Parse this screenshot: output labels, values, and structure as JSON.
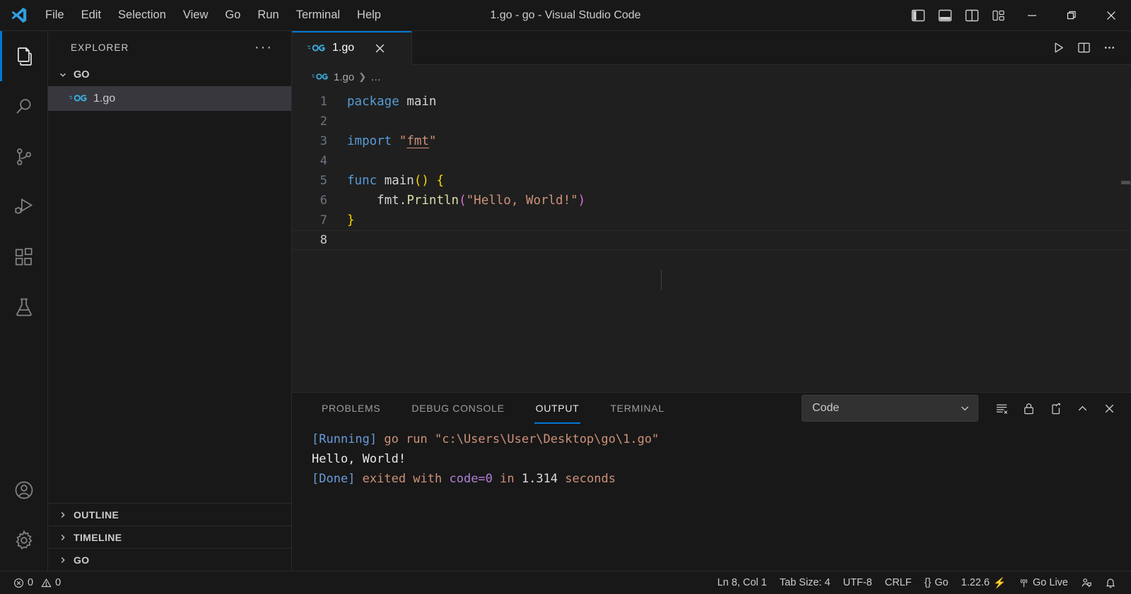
{
  "window": {
    "title": "1.go - go - Visual Studio Code",
    "menu": [
      "File",
      "Edit",
      "Selection",
      "View",
      "Go",
      "Run",
      "Terminal",
      "Help"
    ],
    "layout_buttons": [
      {
        "name": "toggle-primary-sidebar",
        "label": "Toggle Primary Side Bar"
      },
      {
        "name": "toggle-panel",
        "label": "Toggle Panel"
      },
      {
        "name": "toggle-secondary-sidebar",
        "label": "Toggle Secondary Side Bar"
      },
      {
        "name": "customize-layout",
        "label": "Customize Layout"
      }
    ],
    "controls": {
      "minimize": "—",
      "restore": "❐",
      "close": "✕"
    }
  },
  "activity_bar": {
    "items": [
      {
        "name": "explorer",
        "label": "Explorer",
        "icon": "files-icon",
        "active": true
      },
      {
        "name": "search",
        "label": "Search",
        "icon": "search-icon",
        "active": false
      },
      {
        "name": "source-control",
        "label": "Source Control",
        "icon": "source-control-icon",
        "active": false
      },
      {
        "name": "run-debug",
        "label": "Run and Debug",
        "icon": "run-debug-icon",
        "active": false
      },
      {
        "name": "extensions",
        "label": "Extensions",
        "icon": "extensions-icon",
        "active": false
      },
      {
        "name": "testing",
        "label": "Testing",
        "icon": "beaker-icon",
        "active": false
      }
    ],
    "bottom_items": [
      {
        "name": "accounts",
        "label": "Accounts",
        "icon": "account-icon"
      },
      {
        "name": "settings",
        "label": "Manage",
        "icon": "gear-icon"
      }
    ]
  },
  "sidebar": {
    "title": "EXPLORER",
    "more_actions": "···",
    "folder": {
      "label": "GO",
      "expanded": true
    },
    "files": [
      {
        "label": "1.go",
        "icon": "go-file-icon",
        "selected": true
      }
    ],
    "collapsed_sections": [
      {
        "label": "OUTLINE"
      },
      {
        "label": "TIMELINE"
      },
      {
        "label": "GO"
      }
    ]
  },
  "editor": {
    "tabs": [
      {
        "label": "1.go",
        "icon": "go-file-icon",
        "active": true,
        "close": "✕"
      }
    ],
    "actions": [
      {
        "name": "run-code-button",
        "icon": "play-icon"
      },
      {
        "name": "split-editor-button",
        "icon": "split-editor-icon"
      },
      {
        "name": "more-actions-button",
        "icon": "ellipsis-icon"
      }
    ],
    "breadcrumb": {
      "file": "1.go",
      "separator": "❯",
      "trail": "…"
    },
    "lines": [
      {
        "num": "1",
        "current": false
      },
      {
        "num": "2",
        "current": false
      },
      {
        "num": "3",
        "current": false
      },
      {
        "num": "4",
        "current": false
      },
      {
        "num": "5",
        "current": false
      },
      {
        "num": "6",
        "current": false
      },
      {
        "num": "7",
        "current": false
      },
      {
        "num": "8",
        "current": true
      }
    ],
    "code": {
      "l1_package": "package",
      "l1_main": "main",
      "l3_import": "import",
      "l3_quote_open": "\"",
      "l3_fmt": "fmt",
      "l3_quote_close": "\"",
      "l5_func": "func",
      "l5_main": "main",
      "l5_parens": "()",
      "l5_brace": "{",
      "l6_indent": "    ",
      "l6_fmt": "fmt",
      "l6_dot": ".",
      "l6_println": "Println",
      "l6_paren_open": "(",
      "l6_string": "\"Hello, World!\"",
      "l6_paren_close": ")",
      "l7_brace": "}"
    }
  },
  "panel": {
    "tabs": [
      {
        "label": "PROBLEMS",
        "active": false
      },
      {
        "label": "DEBUG CONSOLE",
        "active": false
      },
      {
        "label": "OUTPUT",
        "active": true
      },
      {
        "label": "TERMINAL",
        "active": false
      }
    ],
    "channel_select": {
      "value": "Code",
      "chevron": "⌄"
    },
    "actions": [
      {
        "name": "clear-output-button",
        "icon": "clear-all-icon"
      },
      {
        "name": "lock-scroll-button",
        "icon": "lock-icon"
      },
      {
        "name": "open-in-editor-button",
        "icon": "open-in-editor-icon"
      },
      {
        "name": "maximize-panel-button",
        "icon": "chevron-up-icon"
      },
      {
        "name": "close-panel-button",
        "icon": "close-icon"
      }
    ],
    "output": {
      "running_tag": "[Running]",
      "running_cmd": " go run \"c:\\Users\\User\\Desktop\\go\\1.go\"",
      "stdout": "Hello, World!",
      "blank": "",
      "done_tag": "[Done]",
      "done_exited": " exited with ",
      "done_code": "code=0",
      "done_in": " in ",
      "done_time": "1.314",
      "done_seconds": " seconds"
    }
  },
  "status_bar": {
    "errors": "0",
    "warnings": "0",
    "cursor": "Ln 8, Col 1",
    "tab_size": "Tab Size: 4",
    "encoding": "UTF-8",
    "eol": "CRLF",
    "language": "Go",
    "language_prefix": "{}",
    "go_version": "1.22.6",
    "go_live": "Go Live",
    "icons": {
      "error": "error-icon",
      "warning": "warning-icon",
      "lightning": "⚡",
      "broadcast": "broadcast-icon",
      "feedback": "feedback-icon",
      "bell": "bell-icon"
    }
  },
  "colors": {
    "accent": "#0078d4",
    "titlebar_bg": "#181818",
    "editor_bg": "#1f1f1f",
    "selection_bg": "#37373d",
    "keyword": "#569cd6",
    "string": "#ce9178",
    "function": "#dcdcaa",
    "bracket1": "#ffd700",
    "bracket2": "#da70d6"
  }
}
